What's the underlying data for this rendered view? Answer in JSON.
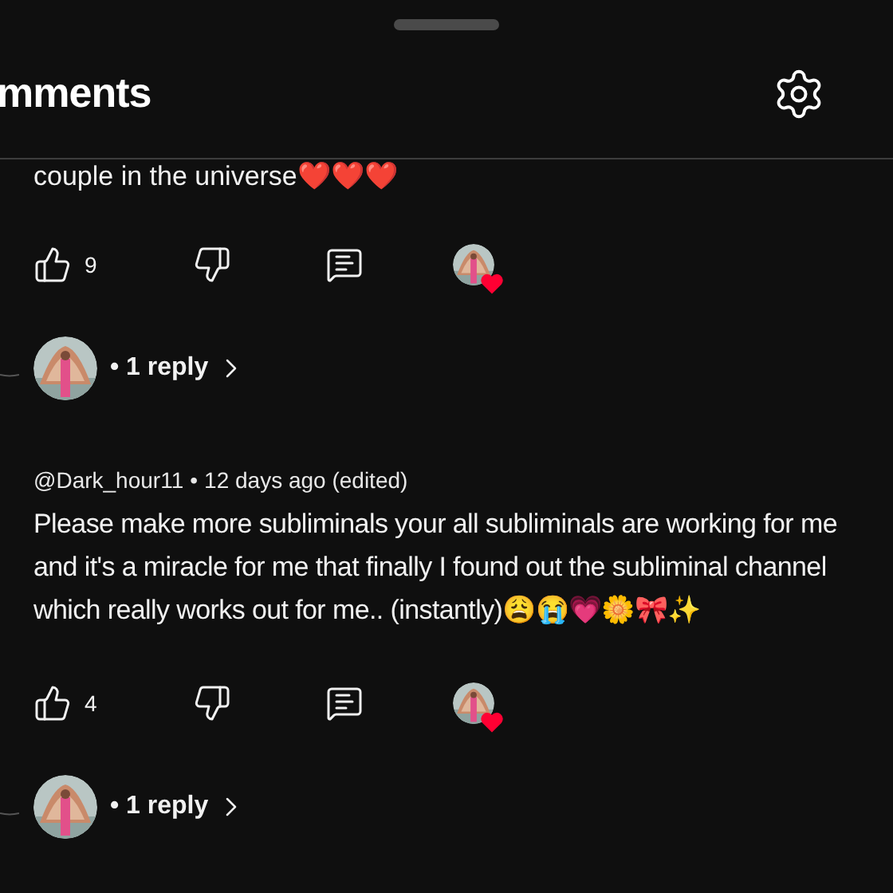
{
  "header": {
    "title": "mments"
  },
  "comments": [
    {
      "text": "couple in the universe❤️❤️❤️",
      "likes": "9",
      "creator_hearted": true,
      "replies": "• 1 reply"
    },
    {
      "author": "@Dark_hour11",
      "separator": "•",
      "time": "12 days ago (edited)",
      "text": "Please make more subliminals your all subliminals are working for me and it's a miracle for me that finally I found out the subliminal channel which really works out for me.. (instantly)😩😭💗🌼🎀✨",
      "likes": "4",
      "creator_hearted": true,
      "replies": "• 1 reply"
    }
  ]
}
